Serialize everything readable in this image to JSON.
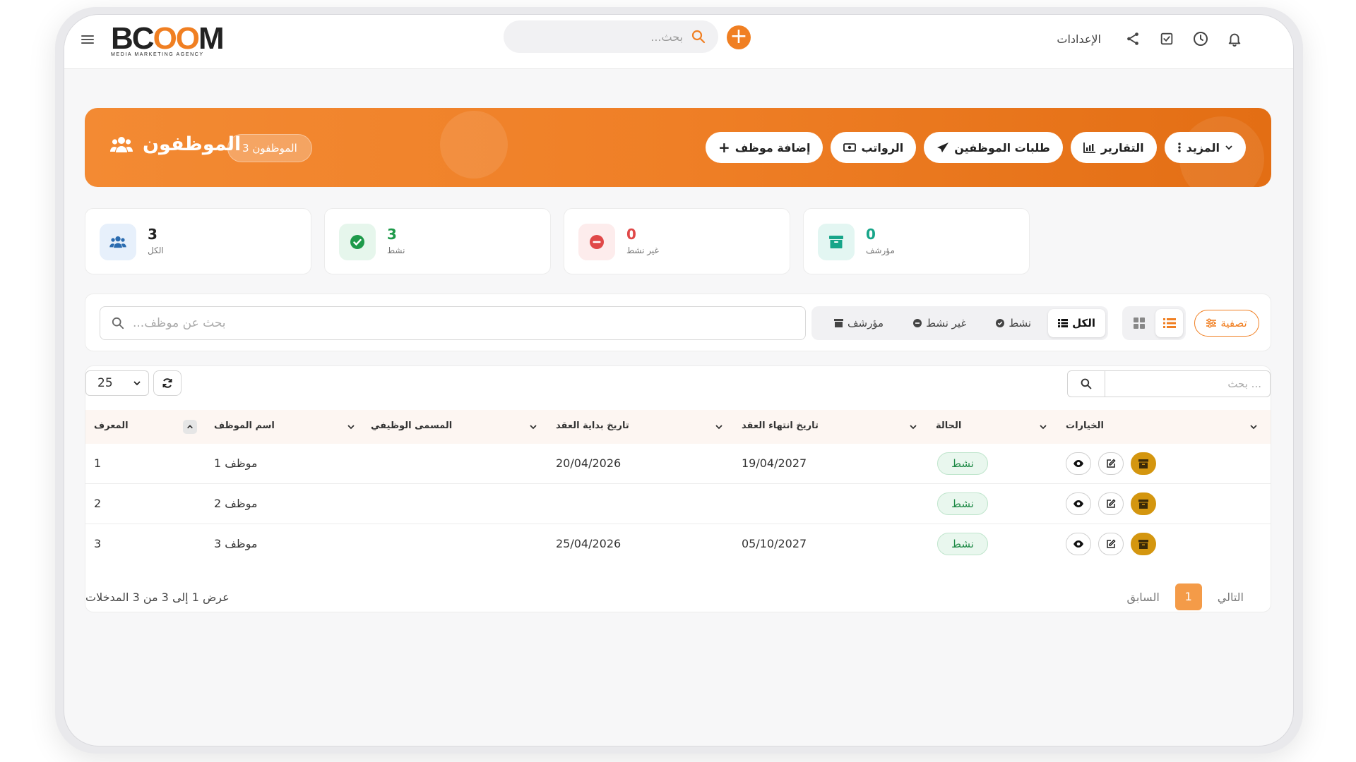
{
  "brand": {
    "logo_main_a": "BC",
    "logo_main_b": "OO",
    "logo_main_c": "M",
    "logo_sub": "MEDIA MARKETING AGENCY",
    "accent": "#f07f22"
  },
  "topbar": {
    "search_placeholder": "بحث...",
    "settings_label": "الإعدادات",
    "icons": [
      "bell-icon",
      "clock-icon",
      "checkbox-icon",
      "share-icon"
    ]
  },
  "hero": {
    "title": "الموظفون",
    "count_badge": "الموظفون 3",
    "actions": [
      {
        "label": "إضافة موظف",
        "icon": "plus-icon"
      },
      {
        "label": "الرواتب",
        "icon": "money-icon"
      },
      {
        "label": "طلبات الموظفين",
        "icon": "send-icon"
      },
      {
        "label": "التقارير",
        "icon": "chart-icon"
      },
      {
        "label": "المزيد",
        "icon": "more-icon"
      }
    ]
  },
  "stats": [
    {
      "value": "3",
      "label": "الكل",
      "color": "#2b6cb0"
    },
    {
      "value": "3",
      "label": "نشط",
      "color": "#1e9a4a"
    },
    {
      "value": "0",
      "label": "غير نشط",
      "color": "#e04848"
    },
    {
      "value": "0",
      "label": "مؤرشف",
      "color": "#17a589"
    }
  ],
  "filters": {
    "search_placeholder": "بحث عن موظف...",
    "tabs": [
      {
        "label": "الكل",
        "active": true
      },
      {
        "label": "نشط",
        "active": false
      },
      {
        "label": "غير نشط",
        "active": false
      },
      {
        "label": "مؤرشف",
        "active": false
      }
    ],
    "filter_label": "تصفية"
  },
  "table": {
    "page_size": "25",
    "search_placeholder": "... بحث",
    "columns": [
      "المعرف",
      "اسم الموظف",
      "المسمى الوظيفي",
      "تاريخ بداية العقد",
      "تاريخ انتهاء العقد",
      "الحالة",
      "الخيارات"
    ],
    "rows": [
      {
        "id": "1",
        "name": "موظف 1",
        "job_title": "",
        "start": "20/04/2026",
        "end": "19/04/2027",
        "status": "نشط"
      },
      {
        "id": "2",
        "name": "موظف 2",
        "job_title": "",
        "start": "",
        "end": "",
        "status": "نشط"
      },
      {
        "id": "3",
        "name": "موظف 3",
        "job_title": "",
        "start": "25/04/2026",
        "end": "05/10/2027",
        "status": "نشط"
      }
    ],
    "footer_info": "عرض 1 إلى 3 من 3 المدخلات",
    "pager": {
      "next": "التالي",
      "current": "1",
      "prev": "السابق"
    }
  }
}
